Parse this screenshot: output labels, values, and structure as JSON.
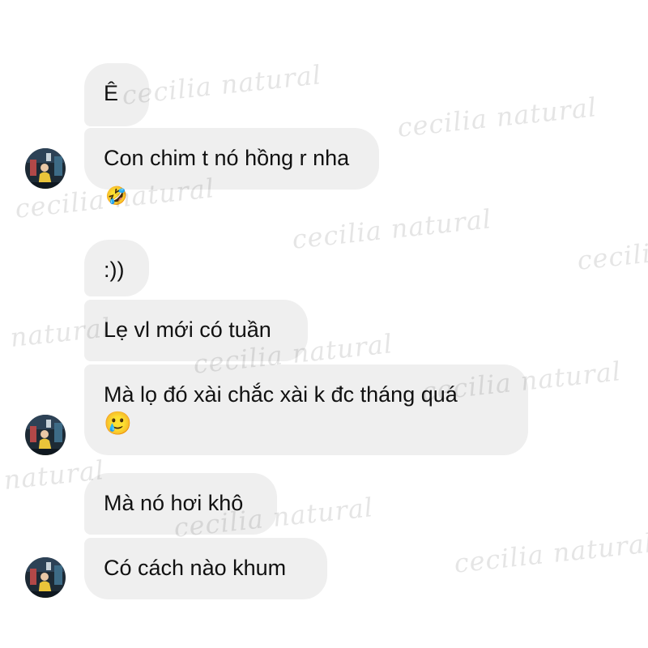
{
  "conversation": {
    "messages": [
      {
        "text": "Ê",
        "emoji": ""
      },
      {
        "text": "Con chim t nó hồng r nha",
        "emoji": ""
      },
      {
        "text": ":))",
        "emoji": ""
      },
      {
        "text": "Lẹ vl mới có tuần",
        "emoji": ""
      },
      {
        "text": "Mà lọ đó xài chắc xài k đc tháng quá",
        "emoji": "🥲"
      },
      {
        "text": "Mà nó hơi khô",
        "emoji": ""
      },
      {
        "text": "Có cách nào khum",
        "emoji": ""
      }
    ],
    "reaction": "🤣"
  },
  "watermark": {
    "text": "cecilia natural"
  },
  "colors": {
    "bubble_background": "#efefef",
    "text": "#111111",
    "page_background": "#ffffff",
    "avatar_accent": "#e9c43a"
  },
  "icons": {
    "avatar": "profile-photo-avatar",
    "reaction": "rolling-on-floor-laughing-emoji"
  }
}
